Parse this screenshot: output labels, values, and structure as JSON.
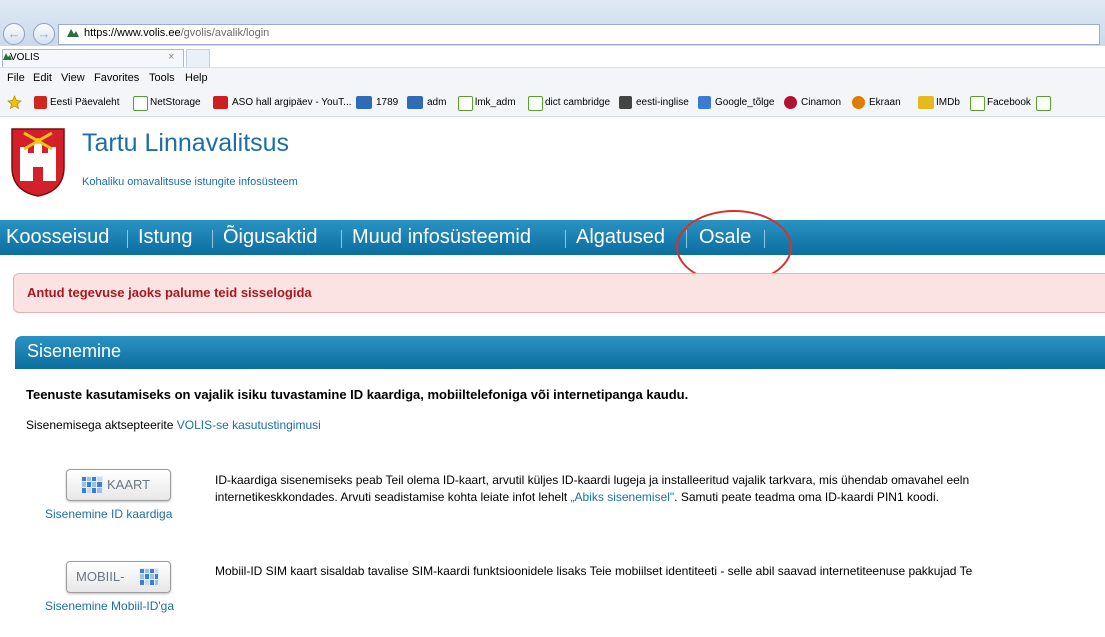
{
  "browser": {
    "url_host": "https://www.volis.ee",
    "url_path": "/gvolis/avalik/login",
    "tab_title": "VOLIS",
    "tab_close": "×",
    "menu": [
      "File",
      "Edit",
      "View",
      "Favorites",
      "Tools",
      "Help"
    ],
    "favorites": [
      {
        "label": "Eesti Päevaleht",
        "icon": "delfi-icon",
        "color": "#d0271f"
      },
      {
        "label": "NetStorage",
        "icon": "ie-page-icon",
        "color": "#5aa02c"
      },
      {
        "label": "ASO hall argipäev - YouT...",
        "icon": "youtube-icon",
        "color": "#cc1f1f"
      },
      {
        "label": "1789",
        "icon": "bar-chart-icon",
        "color": "#2e6db5"
      },
      {
        "label": "adm",
        "icon": "bar-chart-icon",
        "color": "#2e6db5"
      },
      {
        "label": "lmk_adm",
        "icon": "ie-page-icon",
        "color": "#5aa02c"
      },
      {
        "label": "dict cambridge",
        "icon": "ie-page-icon",
        "color": "#5aa02c"
      },
      {
        "label": "eesti-inglise",
        "icon": "dictionary-icon",
        "color": "#333333"
      },
      {
        "label": "Google_tõlge",
        "icon": "translate-icon",
        "color": "#3a7bd5"
      },
      {
        "label": "Cinamon",
        "icon": "cinamon-icon",
        "color": "#b3122f"
      },
      {
        "label": "Ekraan",
        "icon": "ekraan-icon",
        "color": "#e07b00"
      },
      {
        "label": "IMDb",
        "icon": "imdb-icon",
        "color": "#e6b91e"
      },
      {
        "label": "Facebook",
        "icon": "ie-page-icon",
        "color": "#5aa02c"
      }
    ]
  },
  "site": {
    "title": "Tartu Linnavalitsus",
    "subtitle": "Kohaliku omavalitsuse istungite infosüsteem"
  },
  "nav": [
    {
      "label": "Koosseisud"
    },
    {
      "label": "Istung"
    },
    {
      "label": "Õigusaktid"
    },
    {
      "label": "Muud infosüsteemid"
    },
    {
      "label": "Algatused"
    },
    {
      "label": "Osale"
    }
  ],
  "alert": "Antud tegevuse jaoks palume teid sisselogida",
  "login": {
    "heading": "Sisenemine",
    "lead": "Teenuste kasutamiseks on vajalik isiku tuvastamine ID kaardiga, mobiiltelefoniga või internetipanga kaudu.",
    "terms_prefix": "Sisenemisega aktsepteerite ",
    "terms_link": "VOLIS-se kasutustingimusi",
    "idcard": {
      "button_label": "KAART",
      "caption": "Sisenemine ID kaardiga",
      "line1": "ID-kaardiga sisenemiseks peab Teil olema ID-kaart, arvutil küljes ID-kaardi lugeja ja installeeritud vajalik tarkvara, mis ühendab omavahel eeln",
      "line2_prefix": "internetikeskkondades. Arvuti seadistamise kohta leiate infot lehelt ",
      "line2_link": "„Abiks sisenemisel\"",
      "line2_suffix": ". Samuti peate teadma oma ID-kaardi PIN1 koodi."
    },
    "mobile": {
      "button_label": "MOBIIL-",
      "caption": "Sisenemine Mobiil-ID'ga",
      "line1": "Mobiil-ID SIM kaart sisaldab tavalise SIM-kaardi funktsioonidele lisaks Teie mobiilset identiteeti - selle abil saavad internetiteenuse pakkujad Te"
    }
  },
  "colors": {
    "brand_blue": "#1b6fa6",
    "nav_bar": "#1583b8",
    "alert_text": "#a8181f",
    "annotation": "#d8312a"
  }
}
